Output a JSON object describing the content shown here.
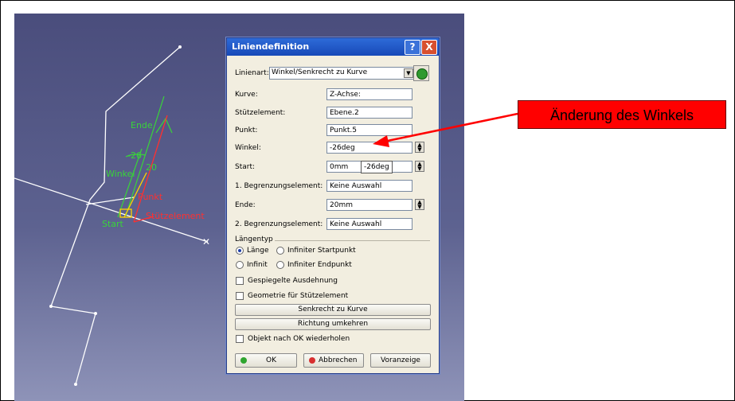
{
  "viewport": {
    "labels": {
      "ende": "Ende",
      "winkel": "Winkel",
      "start": "Start",
      "angle": "-26",
      "angle2": "20",
      "red_a": "Punkt",
      "red_b": "Stützelement"
    }
  },
  "dialog": {
    "title": "Liniendefinition",
    "help": "?",
    "close": "X",
    "linienart_label": "Linienart:",
    "linienart_value": "Winkel/Senkrecht zu Kurve",
    "rows": {
      "kurve_label": "Kurve:",
      "kurve_value": "Z-Achse:",
      "stuetz_label": "Stützelement:",
      "stuetz_value": "Ebene.2",
      "punkt_label": "Punkt:",
      "punkt_value": "Punkt.5",
      "winkel_label": "Winkel:",
      "winkel_value": "-26deg",
      "start_label": "Start:",
      "start_value": "0mm",
      "start_tooltip": "-26deg",
      "begr1_label": "1. Begrenzungselement:",
      "begr1_value": "Keine Auswahl",
      "ende_label": "Ende:",
      "ende_value": "20mm",
      "begr2_label": "2. Begrenzungselement:",
      "begr2_value": "Keine Auswahl"
    },
    "laengentyp": {
      "title": "Längentyp",
      "laenge": "Länge",
      "inf_start": "Infiniter Startpunkt",
      "infinit": "Infinit",
      "inf_end": "Infiniter Endpunkt",
      "selected": "Länge"
    },
    "checks": {
      "gespiegelt": "Gespiegelte Ausdehnung",
      "geometrie": "Geometrie für Stützelement",
      "wiederholen": "Objekt nach OK wiederholen"
    },
    "buttons": {
      "senkrecht": "Senkrecht zu Kurve",
      "richtung": "Richtung umkehren",
      "ok": "OK",
      "abbrechen": "Abbrechen",
      "vorschau": "Voranzeige"
    }
  },
  "callout": {
    "text": "Änderung des Winkels",
    "color": "#ff0000"
  }
}
